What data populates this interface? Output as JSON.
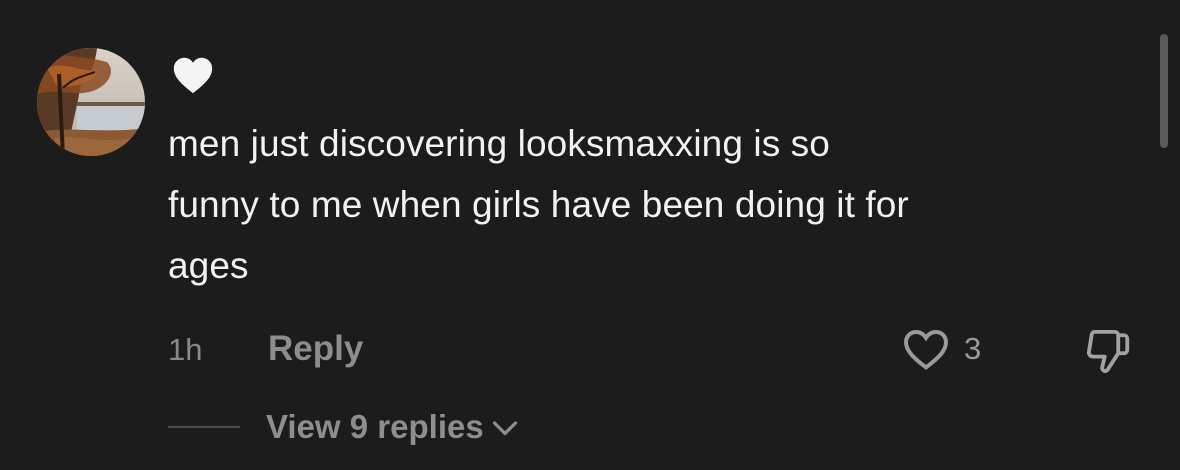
{
  "comment": {
    "text": "men just discovering looksmaxxing is so\nfunny to me when girls have been doing it for\nages",
    "time": "1h",
    "reply_label": "Reply",
    "like_count": "3",
    "view_replies_label": "View 9 replies"
  },
  "icons": {
    "badge": "heart-icon",
    "like": "heart-outline-icon",
    "dislike": "thumbs-down-icon",
    "expand": "chevron-down-icon"
  },
  "colors": {
    "background": "#1c1c1c",
    "text": "#f2f2f2",
    "muted": "#8d8d8d"
  }
}
